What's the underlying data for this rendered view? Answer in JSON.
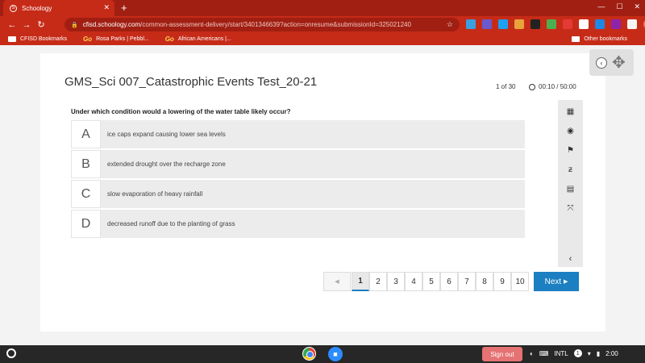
{
  "browser": {
    "tab_title": "Schoology",
    "tab_favicon": "S",
    "url_domain": "cfisd.schoology.com",
    "url_path": "/common-assessment-delivery/start/3401346639?action=onresume&submissionId=325021240",
    "bookmarks": [
      {
        "label": "CFISD Bookmarks",
        "icon": "folder-icon"
      },
      {
        "label": "Rosa Parks | Pebbl...",
        "icon": "go-icon"
      },
      {
        "label": "African Americans |...",
        "icon": "go-icon"
      }
    ],
    "other_bookmarks": "Other bookmarks",
    "go_label": "Go"
  },
  "assessment": {
    "title": "GMS_Sci 007_Catastrophic Events Test_20-21",
    "counter": "1 of 30",
    "timer": "00:10 / 50:00",
    "question": "Under which condition would a lowering of the water table likely occur?",
    "answers": [
      {
        "letter": "A",
        "text": "ice caps expand causing lower sea levels"
      },
      {
        "letter": "B",
        "text": "extended drought over the recharge zone"
      },
      {
        "letter": "C",
        "text": "slow evaporation of heavy rainfall"
      },
      {
        "letter": "D",
        "text": "decreased runoff due to the planting of grass"
      }
    ],
    "pages": [
      "1",
      "2",
      "3",
      "4",
      "5",
      "6",
      "7",
      "8",
      "9",
      "10"
    ],
    "current_page": "1",
    "next_label": "Next"
  },
  "shelf": {
    "signout": "Sign out",
    "input_method": "INTL",
    "notif_count": "1",
    "time": "2:00"
  },
  "colors": {
    "chrome_red": "#c62b18",
    "accent_blue": "#1b7fc1"
  }
}
